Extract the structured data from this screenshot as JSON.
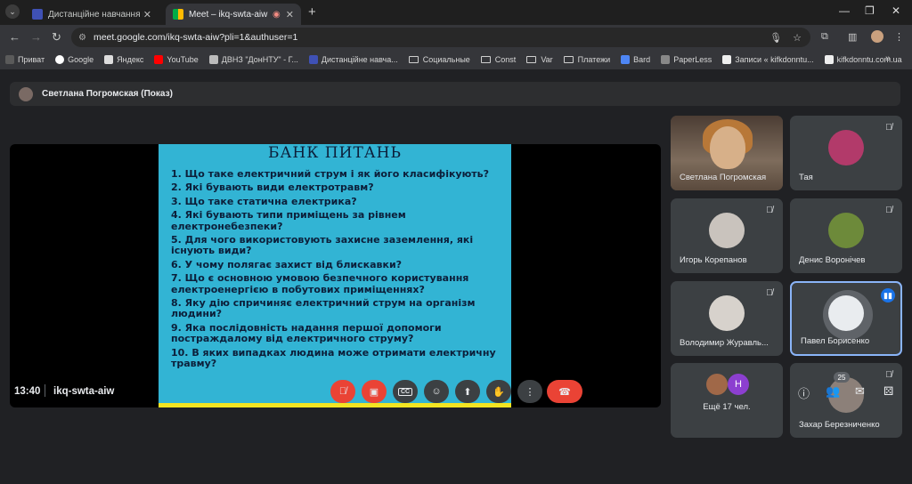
{
  "browser": {
    "tabs": [
      {
        "title": "Дистанційне навчання в ВСП ",
        "active": false
      },
      {
        "title": "Meet – ikq-swta-aiw",
        "active": true
      }
    ],
    "url": "meet.google.com/ikq-swta-aiw?pli=1&authuser=1",
    "bookmarks": [
      {
        "label": "Приват",
        "icon": "privat-icon"
      },
      {
        "label": "Google",
        "icon": "google-icon"
      },
      {
        "label": "Яндекс",
        "icon": "yandex-icon"
      },
      {
        "label": "YouTube",
        "icon": "youtube-icon"
      },
      {
        "label": "ДВНЗ \"ДонНТУ\" - Г...",
        "icon": "site-icon"
      },
      {
        "label": "Дистанційне навча...",
        "icon": "site-icon"
      },
      {
        "label": "Социальные",
        "icon": "folder-icon"
      },
      {
        "label": "Const",
        "icon": "folder-icon"
      },
      {
        "label": "Var",
        "icon": "folder-icon"
      },
      {
        "label": "Платежи",
        "icon": "folder-icon"
      },
      {
        "label": "Bard",
        "icon": "bard-icon"
      },
      {
        "label": "PaperLess",
        "icon": "site-icon"
      },
      {
        "label": "Записи « kifkdonntu...",
        "icon": "site-icon"
      },
      {
        "label": "kifkdonntu.com.ua",
        "icon": "site-icon"
      }
    ]
  },
  "meet": {
    "presenter_label": "Светлана Погромская (Показ)",
    "slide": {
      "title": "БАНК ПИТАНЬ",
      "questions": [
        "1. Що таке електричний струм і як його класифікують?",
        "2. Які бувають види електротравм?",
        "3. Що таке статична електрика?",
        "4. Які бувають типи приміщень за рівнем електронебезпеки?",
        "5. Для чого використовують захисне заземлення, які існують види?",
        "6. У чому полягає захист від блискавки?",
        "7. Що є основною умовою безпечного користування електроенергією в побутових приміщеннях?",
        "8. Яку дію спричиняє електричний струм на організм людини?",
        "9. Яка послідовність надання першої допомоги постраждалому від електричного струму?",
        "10. В яких випадках людина може отримати електричну травму?"
      ]
    },
    "participants": [
      {
        "name": "Светлана Погромская"
      },
      {
        "name": "Тая"
      },
      {
        "name": "Игорь Корепанов"
      },
      {
        "name": "Денис Воронічев"
      },
      {
        "name": "Володимир Журавль..."
      },
      {
        "name": "Павел Борисенко"
      },
      {
        "name": "Захар Березниченко"
      }
    ],
    "more_label": "Ещё 17 чел.",
    "more_initial": "H",
    "time": "13:40",
    "meeting_code": "ikq-swta-aiw",
    "participant_count": "25",
    "accent_color": "#8ab4f8",
    "end_color": "#ea4335"
  }
}
